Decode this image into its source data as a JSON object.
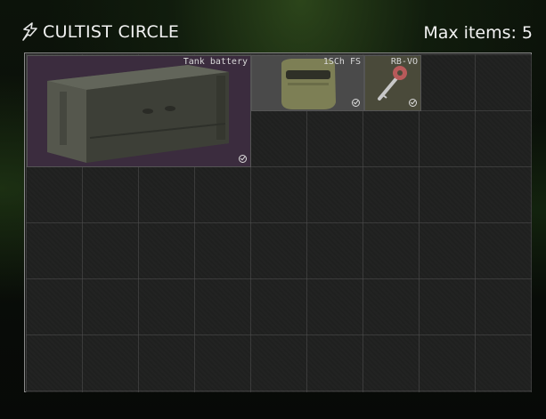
{
  "header": {
    "title": "CULTIST CIRCLE",
    "max_items_label": "Max items:",
    "max_items_value": "5",
    "logo_icon": "cultist-sigil-icon"
  },
  "grid": {
    "columns": 9,
    "rows": 6
  },
  "items": [
    {
      "name": "Tank battery",
      "icon": "battery-box-icon",
      "status": "checked"
    },
    {
      "name": "1SCh FS",
      "icon": "helmet-faceshield-icon",
      "status": "checked"
    },
    {
      "name": "RB-VO",
      "icon": "key-icon",
      "status": "checked"
    }
  ],
  "colors": {
    "tank_bg": "#3b2c3e",
    "helmet_bg": "#4a4a4a",
    "key_bg": "#4a4a3a"
  }
}
